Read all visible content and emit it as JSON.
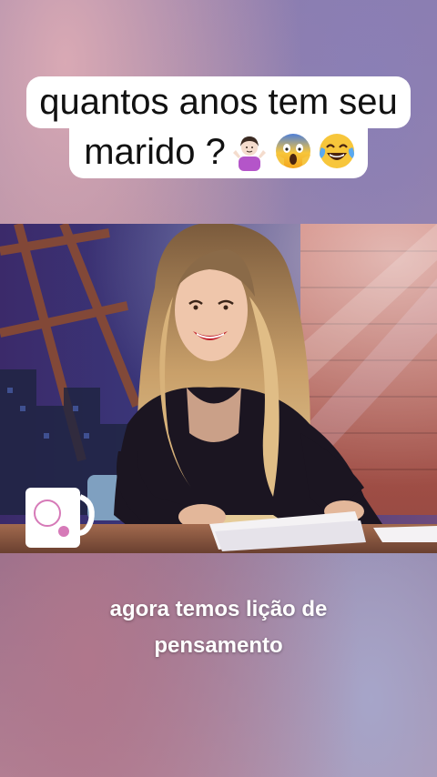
{
  "caption": {
    "line1": "quantos anos tem seu",
    "line2": "marido ?",
    "emojis": [
      "person-shrugging-icon",
      "face-screaming-in-fear-icon",
      "face-with-tears-of-joy-icon"
    ]
  },
  "subtitle": {
    "line1": "agora temos lição de",
    "line2": "pensamento"
  },
  "colors": {
    "caption_bg": "#ffffff",
    "caption_text": "#111111",
    "subtitle_text": "#ffffff"
  }
}
